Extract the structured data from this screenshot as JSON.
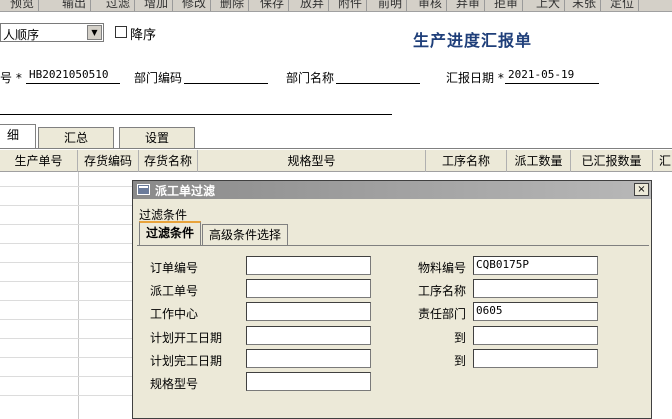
{
  "toolbar": {
    "buttons": [
      "预览",
      "输出",
      "过滤",
      "增加",
      "修改",
      "删除",
      "保存",
      "放弃",
      "附件",
      "前明",
      "审核",
      "弃审",
      "拒审",
      "上大",
      "末张",
      "定位"
    ]
  },
  "sort": {
    "selected": "人顺序",
    "descending_label": "降序"
  },
  "form": {
    "title": "生产进度汇报单",
    "fields": {
      "number_label": "号",
      "number_value": "HB2021050510",
      "dept_code_label": "部门编码",
      "dept_name_label": "部门名称",
      "report_date_label": "汇报日期",
      "report_date_value": "2021-05-19"
    }
  },
  "tabs": [
    "细",
    "汇总",
    "设置"
  ],
  "grid": {
    "columns": [
      "生产单号",
      "存货编码",
      "存货名称",
      "规格型号",
      "工序名称",
      "派工数量",
      "已汇报数量",
      "汇"
    ]
  },
  "dialog": {
    "title": "派工单过滤",
    "close_label": "×",
    "group_label": "过滤条件",
    "tabs": [
      "过滤条件",
      "高级条件选择"
    ],
    "left_fields": [
      {
        "label": "订单编号",
        "value": ""
      },
      {
        "label": "派工单号",
        "value": ""
      },
      {
        "label": "工作中心",
        "value": ""
      },
      {
        "label": "计划开工日期",
        "value": ""
      },
      {
        "label": "计划完工日期",
        "value": ""
      },
      {
        "label": "规格型号",
        "value": ""
      }
    ],
    "right_fields": [
      {
        "label": "物料编号",
        "value": "CQB0175P"
      },
      {
        "label": "工序名称",
        "value": ""
      },
      {
        "label": "责任部门",
        "value": "0605"
      },
      {
        "label": "到",
        "value": ""
      },
      {
        "label": "到",
        "value": ""
      }
    ]
  }
}
